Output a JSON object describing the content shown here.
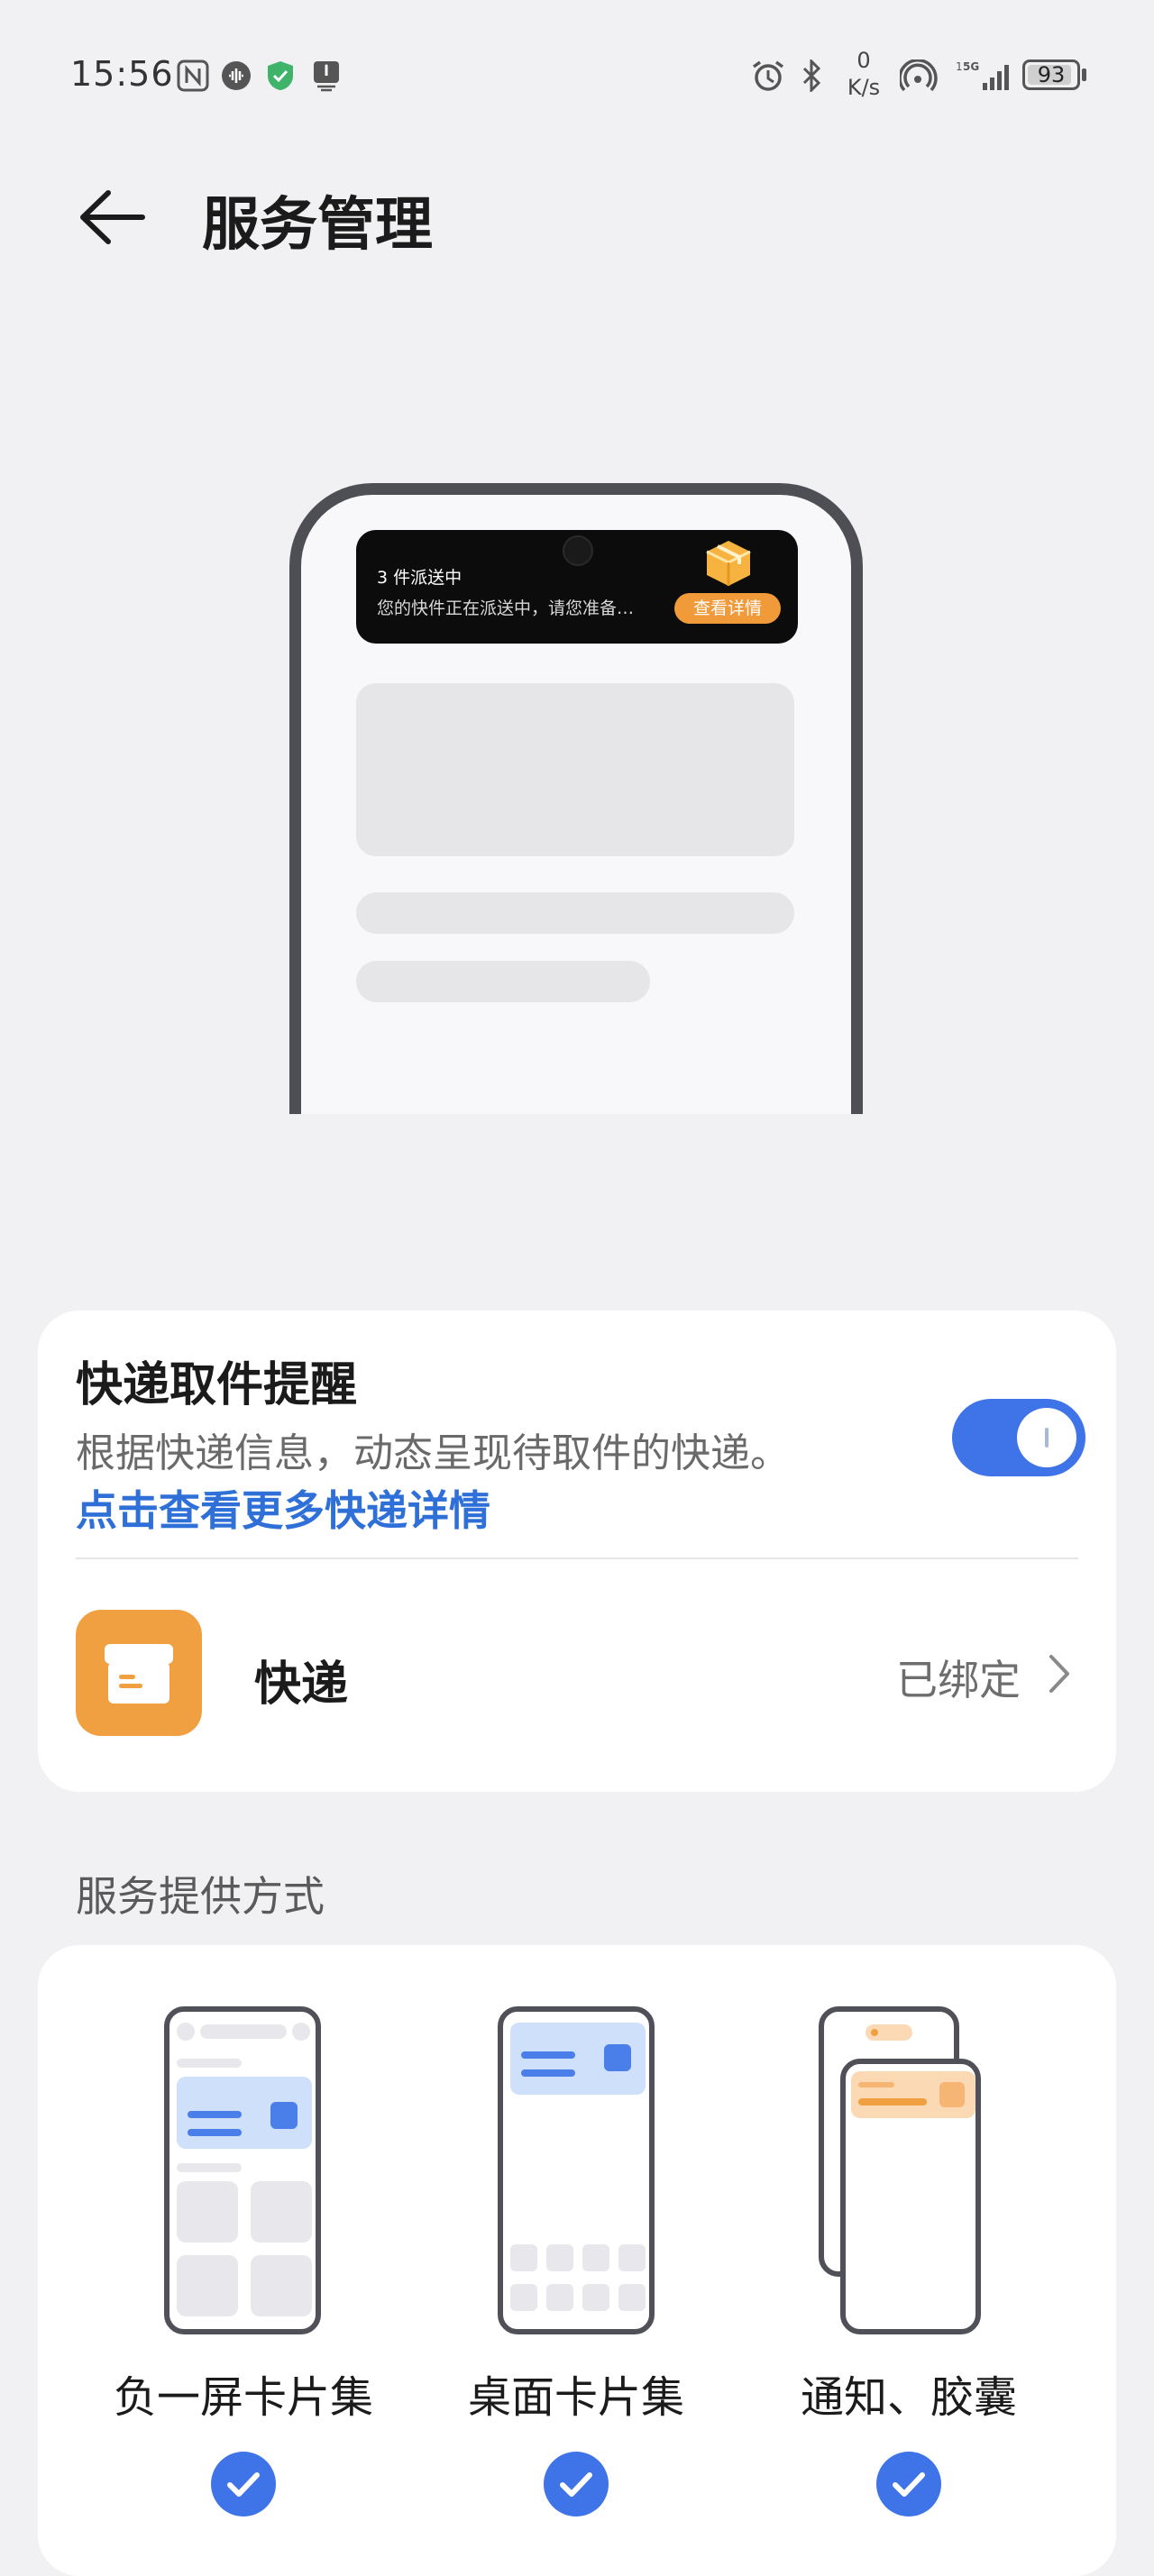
{
  "status_bar": {
    "time": "15:56",
    "network_rate_value": "0",
    "network_rate_unit": "K/s",
    "battery": "93",
    "battery_level": 0.93,
    "icons": [
      "nfc-icon",
      "voice-icon",
      "shield-icon",
      "notification-icon",
      "alarm-icon",
      "bluetooth-icon",
      "hotspot-icon",
      "5g-signal-icon"
    ]
  },
  "header": {
    "back_icon": "back-arrow-icon",
    "title": "服务管理"
  },
  "preview": {
    "island_title": "3 件派送中",
    "island_subtitle": "您的快件正在派送中，请您准备…",
    "island_button": "查看详情"
  },
  "service": {
    "title": "快递取件提醒",
    "description": "根据快递信息，动态呈现待取件的快递。",
    "link": "点击查看更多快递详情",
    "toggle_on": true,
    "accent": "#3f73e8",
    "app_name": "快递",
    "app_icon_color": "#f0a040",
    "bind_status": "已绑定"
  },
  "modes": {
    "section_title": "服务提供方式",
    "items": [
      {
        "label": "负一屏卡片集",
        "checked": true
      },
      {
        "label": "桌面卡片集",
        "checked": true
      },
      {
        "label": "通知、胶囊",
        "checked": true
      }
    ]
  }
}
